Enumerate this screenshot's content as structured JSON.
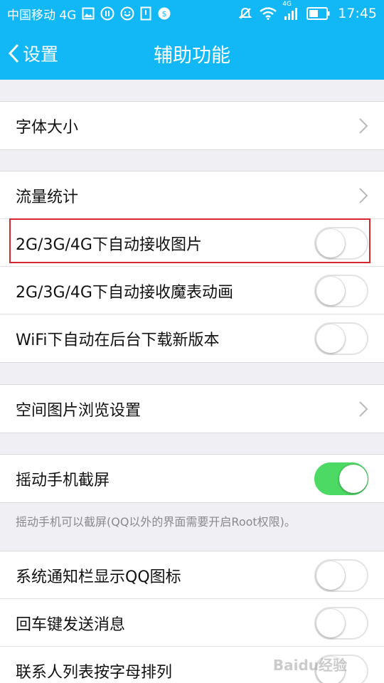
{
  "status_bar": {
    "carrier": "中国移动 4G",
    "network_badge": "4G",
    "time": "17:45",
    "icons": [
      "image-icon",
      "pause-circle-icon",
      "smile-icon",
      "sim-icon",
      "shield-icon",
      "mute-icon",
      "wifi-icon",
      "signal-icon",
      "battery-icon"
    ]
  },
  "header": {
    "back_label": "设置",
    "title": "辅助功能",
    "accent": "#12b7f5"
  },
  "sections": [
    {
      "rows": [
        {
          "label": "字体大小",
          "control": "chevron"
        }
      ]
    },
    {
      "rows": [
        {
          "label": "流量统计",
          "control": "chevron"
        },
        {
          "label": "2G/3G/4G下自动接收图片",
          "control": "toggle",
          "on": false
        },
        {
          "label": "2G/3G/4G下自动接收魔表动画",
          "control": "toggle",
          "on": false
        },
        {
          "label": "WiFi下自动在后台下载新版本",
          "control": "toggle",
          "on": false
        }
      ]
    },
    {
      "rows": [
        {
          "label": "空间图片浏览设置",
          "control": "chevron"
        }
      ]
    },
    {
      "rows": [
        {
          "label": "摇动手机截屏",
          "control": "toggle",
          "on": true
        }
      ]
    },
    {
      "rows": [
        {
          "label": "系统通知栏显示QQ图标",
          "control": "toggle",
          "on": false
        },
        {
          "label": "回车键发送消息",
          "control": "toggle",
          "on": false
        },
        {
          "label": "联系人列表按字母排列",
          "control": "toggle",
          "on": false
        }
      ]
    }
  ],
  "note": "摇动手机可以截屏(QQ以外的界面需要开启Root权限)。",
  "watermark": "Baidu经验",
  "colors": {
    "toggle_on": "#4cd964",
    "highlight": "#d6262f",
    "background": "#efeff4"
  }
}
